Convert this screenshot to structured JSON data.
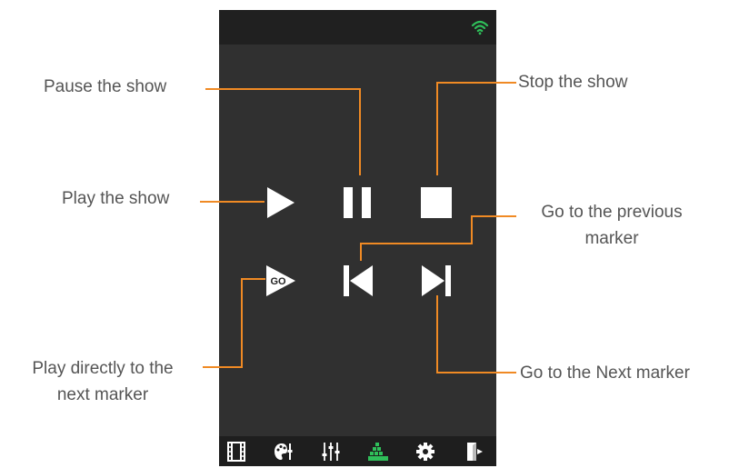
{
  "colors": {
    "screen_bg": "#303030",
    "statusbar_bg": "#202020",
    "navbar_bg": "#1e1e1e",
    "icon": "#ffffff",
    "accent": "#2fbf5a",
    "callout_line": "#f08a24",
    "callout_text": "#555555"
  },
  "statusbar": {
    "icon": "wifi-icon"
  },
  "controls": {
    "play": {
      "icon": "play-icon"
    },
    "pause": {
      "icon": "pause-icon"
    },
    "stop": {
      "icon": "stop-icon"
    },
    "play_to_marker": {
      "icon": "play-go-icon",
      "badge": "GO"
    },
    "previous_marker": {
      "icon": "skip-previous-icon"
    },
    "next_marker": {
      "icon": "skip-next-icon"
    }
  },
  "navbar": {
    "items": [
      {
        "icon": "film-icon",
        "active": false
      },
      {
        "icon": "palette-icon",
        "active": false
      },
      {
        "icon": "sliders-icon",
        "active": false
      },
      {
        "icon": "stairs-icon",
        "active": true
      },
      {
        "icon": "gear-icon",
        "active": false
      },
      {
        "icon": "exit-icon",
        "active": false
      }
    ]
  },
  "callouts": {
    "pause": "Pause the show",
    "stop": "Stop the show",
    "play": "Play the show",
    "previous_line1": "Go to the previous",
    "previous_line2": "marker",
    "play_direct_line1": "Play directly to the",
    "play_direct_line2": "next marker",
    "next": "Go to the Next marker"
  }
}
